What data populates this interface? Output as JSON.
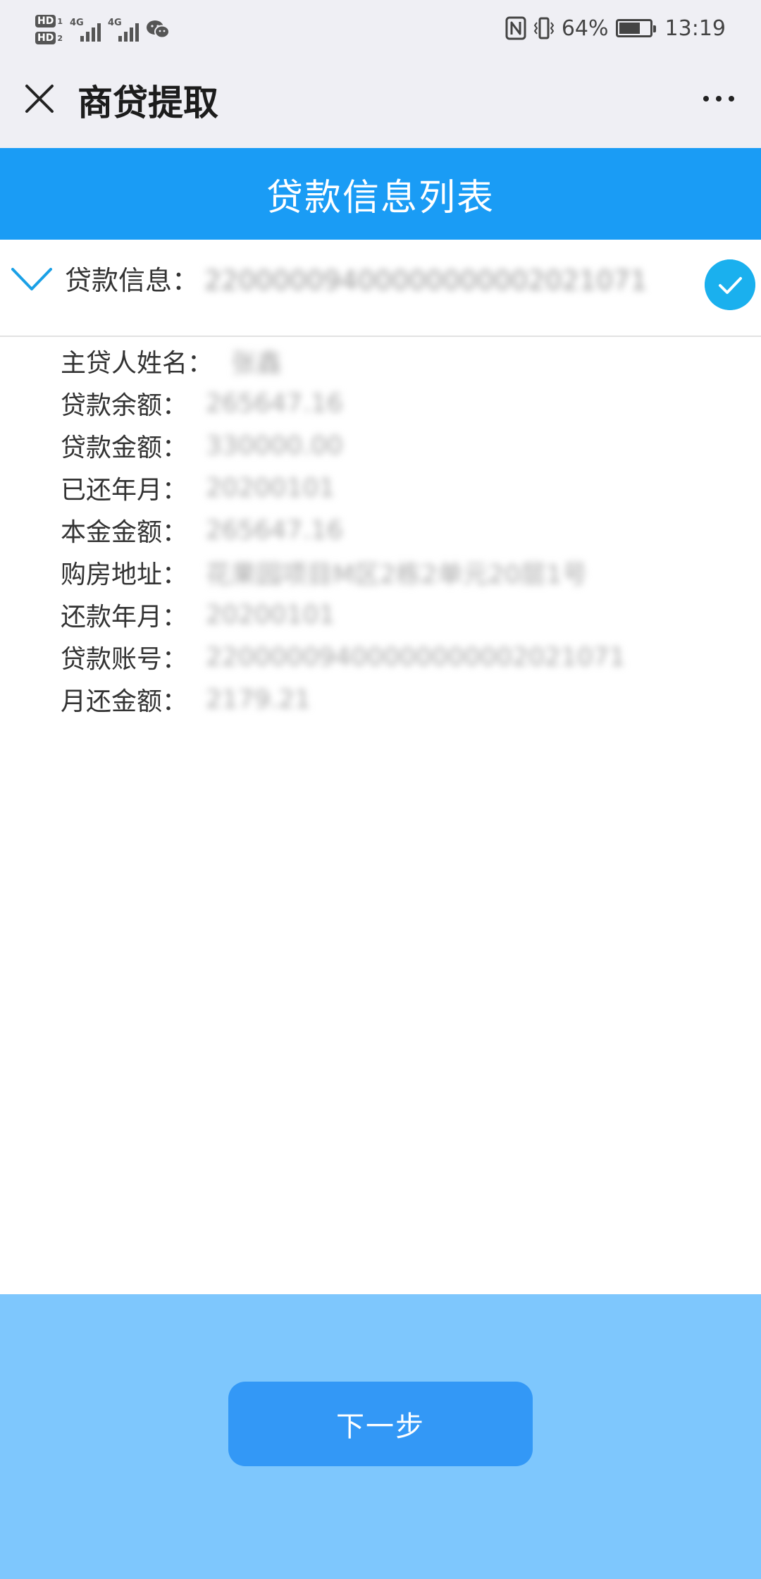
{
  "status_bar": {
    "hd_label": "HD",
    "sim1": "1",
    "sim2": "2",
    "network1": "4G",
    "network2": "4G",
    "battery": "64%",
    "time": "13:19"
  },
  "app": {
    "title": "商贷提取"
  },
  "header": {
    "title": "贷款信息列表"
  },
  "loan": {
    "label": "贷款信息：",
    "value": "22000009400000000002021071",
    "selected": true
  },
  "details": [
    {
      "label": "主贷人姓名：",
      "value": "张鑫"
    },
    {
      "label": "贷款余额：",
      "value": "265647.16"
    },
    {
      "label": "贷款金额：",
      "value": "330000.00"
    },
    {
      "label": "已还年月：",
      "value": "20200101"
    },
    {
      "label": "本金金额：",
      "value": "265647.16"
    },
    {
      "label": "购房地址：",
      "value": "花果园项目M区2栋2单元20层1号"
    },
    {
      "label": "还款年月：",
      "value": "20200101"
    },
    {
      "label": "贷款账号：",
      "value": "22000009400000000002021071"
    },
    {
      "label": "月还金额：",
      "value": "2179.21"
    }
  ],
  "footer": {
    "next_label": "下一步"
  },
  "colors": {
    "header_blue": "#1a9cf5",
    "check_blue": "#1ab0ee",
    "footer_blue": "#7ec7fd",
    "button_blue": "#3398f6"
  }
}
